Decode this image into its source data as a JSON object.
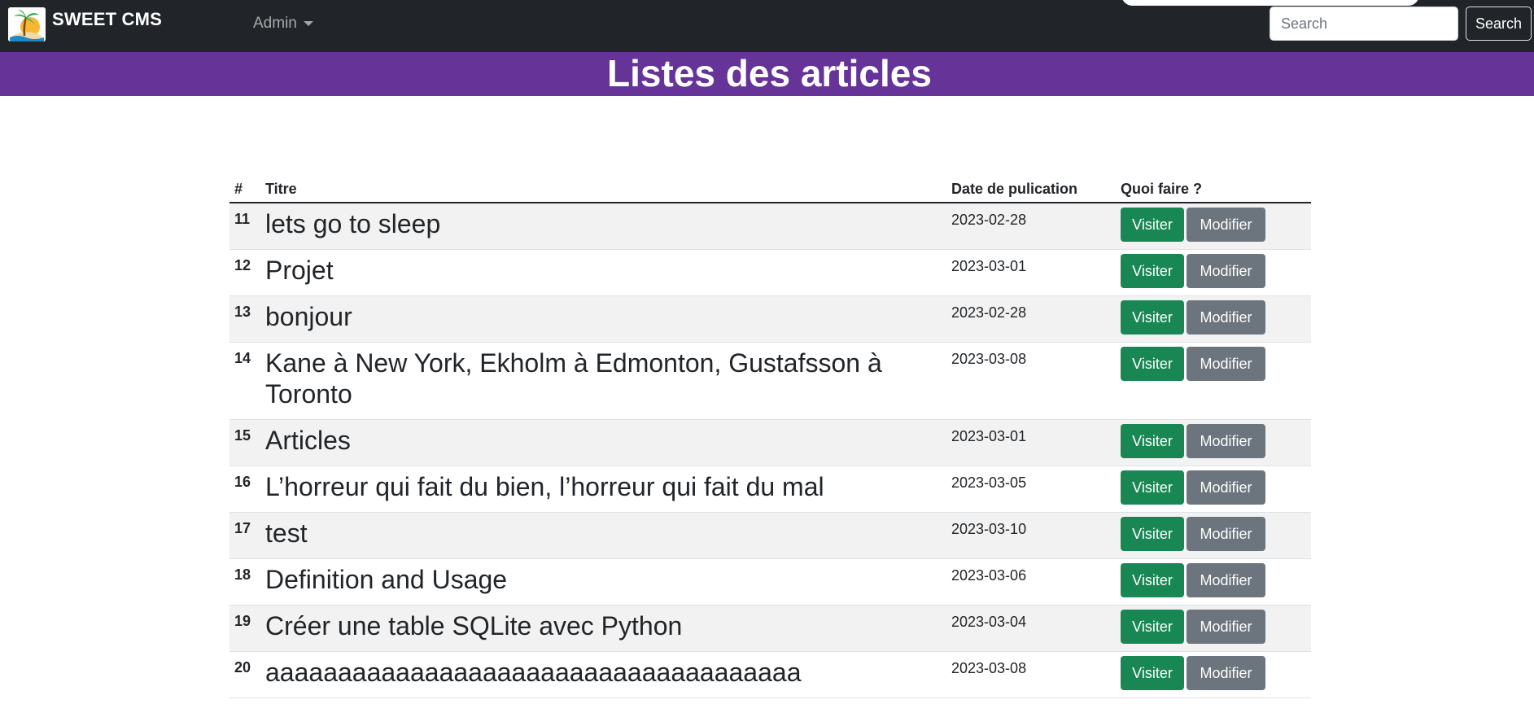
{
  "navbar": {
    "brand_name": "SWEET CMS",
    "admin_menu_label": "Admin",
    "search_placeholder": "Search",
    "search_button_label": "Search"
  },
  "header": {
    "title": "Listes des articles"
  },
  "table": {
    "columns": [
      "#",
      "Titre",
      "Date de pulication",
      "Quoi faire ?"
    ],
    "rows": [
      {
        "id": "11",
        "title": "lets go to sleep",
        "date": "2023-02-28",
        "visit": "Visiter",
        "edit": "Modifier"
      },
      {
        "id": "12",
        "title": "Projet",
        "date": "2023-03-01",
        "visit": "Visiter",
        "edit": "Modifier"
      },
      {
        "id": "13",
        "title": "bonjour",
        "date": "2023-02-28",
        "visit": "Visiter",
        "edit": "Modifier"
      },
      {
        "id": "14",
        "title": "Kane à New York, Ekholm à Edmonton, Gustafsson à Toronto",
        "date": "2023-03-08",
        "visit": "Visiter",
        "edit": "Modifier"
      },
      {
        "id": "15",
        "title": "Articles",
        "date": "2023-03-01",
        "visit": "Visiter",
        "edit": "Modifier"
      },
      {
        "id": "16",
        "title": "L’horreur qui fait du bien, l’horreur qui fait du mal",
        "date": "2023-03-05",
        "visit": "Visiter",
        "edit": "Modifier"
      },
      {
        "id": "17",
        "title": "test",
        "date": "2023-03-10",
        "visit": "Visiter",
        "edit": "Modifier"
      },
      {
        "id": "18",
        "title": "Definition and Usage",
        "date": "2023-03-06",
        "visit": "Visiter",
        "edit": "Modifier"
      },
      {
        "id": "19",
        "title": "Créer une table SQLite avec Python",
        "date": "2023-03-04",
        "visit": "Visiter",
        "edit": "Modifier"
      },
      {
        "id": "20",
        "title": "aaaaaaaaaaaaaaaaaaaaaaaaaaaaaaaaaaaaa",
        "date": "2023-03-08",
        "visit": "Visiter",
        "edit": "Modifier"
      }
    ]
  },
  "colors": {
    "navbar_bg": "#212529",
    "header_band": "#663399",
    "visit_button": "#198754",
    "edit_button": "#6c757d",
    "stripe": "#f2f2f2"
  }
}
